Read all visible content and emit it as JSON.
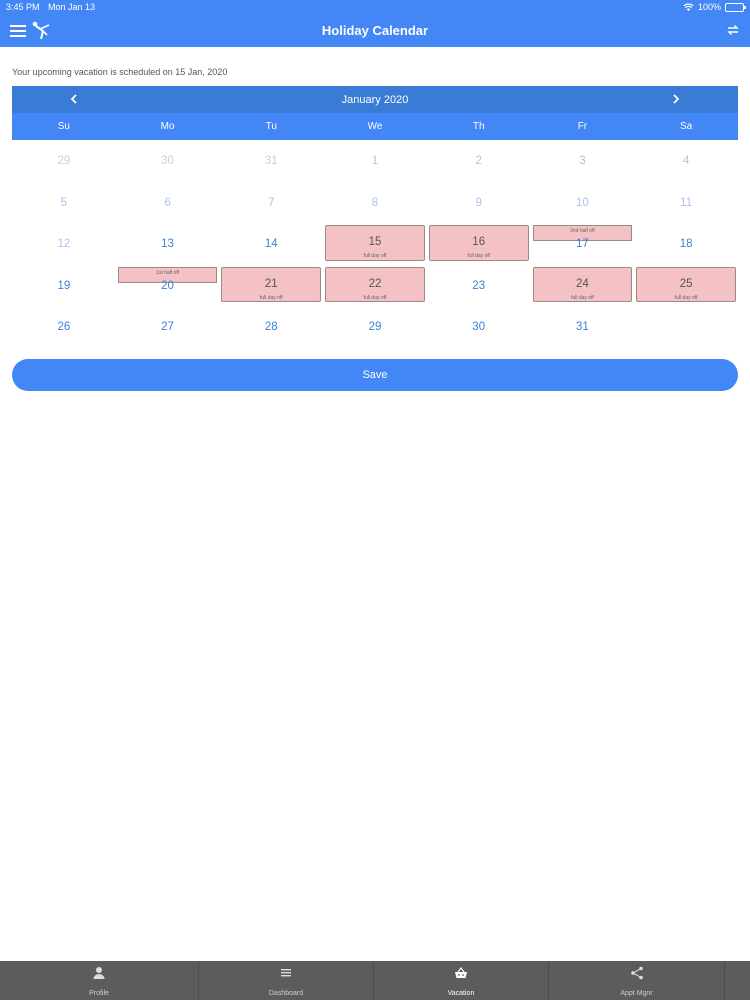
{
  "status": {
    "time": "3:45 PM",
    "date": "Mon Jan 13",
    "battery": "100%",
    "battery_level": 1.0
  },
  "nav": {
    "title": "Holiday Calendar",
    "menu_icon": "menu-icon",
    "logo_icon": "app-logo-icon",
    "sync_icon": "sync-icon"
  },
  "subtitle": "Your upcoming vacation is scheduled on 15 Jan, 2020",
  "calendar": {
    "month_label": "January 2020",
    "weekdays": [
      "Su",
      "Mo",
      "Tu",
      "We",
      "Th",
      "Fr",
      "Sa"
    ],
    "days": [
      {
        "n": "29",
        "state": "muted"
      },
      {
        "n": "30",
        "state": "muted"
      },
      {
        "n": "31",
        "state": "muted"
      },
      {
        "n": "1",
        "state": "past"
      },
      {
        "n": "2",
        "state": "past"
      },
      {
        "n": "3",
        "state": "past"
      },
      {
        "n": "4",
        "state": "past"
      },
      {
        "n": "5",
        "state": "past"
      },
      {
        "n": "6",
        "state": "past"
      },
      {
        "n": "7",
        "state": "past"
      },
      {
        "n": "8",
        "state": "past"
      },
      {
        "n": "9",
        "state": "past"
      },
      {
        "n": "10",
        "state": "past"
      },
      {
        "n": "11",
        "state": "past"
      },
      {
        "n": "12",
        "state": "past"
      },
      {
        "n": "13",
        "state": "normal"
      },
      {
        "n": "14",
        "state": "normal"
      },
      {
        "n": "15",
        "state": "full",
        "note": "full day off"
      },
      {
        "n": "16",
        "state": "full",
        "note": "full day off"
      },
      {
        "n": "17",
        "state": "half",
        "note": "2nd half off"
      },
      {
        "n": "18",
        "state": "normal"
      },
      {
        "n": "19",
        "state": "normal"
      },
      {
        "n": "20",
        "state": "half",
        "note": "1st half off"
      },
      {
        "n": "21",
        "state": "full",
        "note": "full day off"
      },
      {
        "n": "22",
        "state": "full",
        "note": "full day off"
      },
      {
        "n": "23",
        "state": "normal"
      },
      {
        "n": "24",
        "state": "full",
        "note": "full day off"
      },
      {
        "n": "25",
        "state": "full",
        "note": "full day off"
      },
      {
        "n": "26",
        "state": "normal"
      },
      {
        "n": "27",
        "state": "normal"
      },
      {
        "n": "28",
        "state": "normal"
      },
      {
        "n": "29",
        "state": "normal"
      },
      {
        "n": "30",
        "state": "normal"
      },
      {
        "n": "31",
        "state": "normal"
      },
      {
        "n": "",
        "state": "empty"
      }
    ]
  },
  "save_label": "Save",
  "tabs": [
    {
      "label": "Profile",
      "icon": "profile-icon",
      "active": false
    },
    {
      "label": "Dashboard",
      "icon": "list-icon",
      "active": false
    },
    {
      "label": "Vacation",
      "icon": "basket-icon",
      "active": true
    },
    {
      "label": "Appt Mgnr",
      "icon": "share-icon",
      "active": false
    }
  ],
  "colors": {
    "primary": "#4287f5",
    "header_dark": "#3a7bd5",
    "day_blue": "#3b82d6",
    "vacation_fill": "#f4c2c5",
    "tabbar": "#5c5c5c"
  }
}
